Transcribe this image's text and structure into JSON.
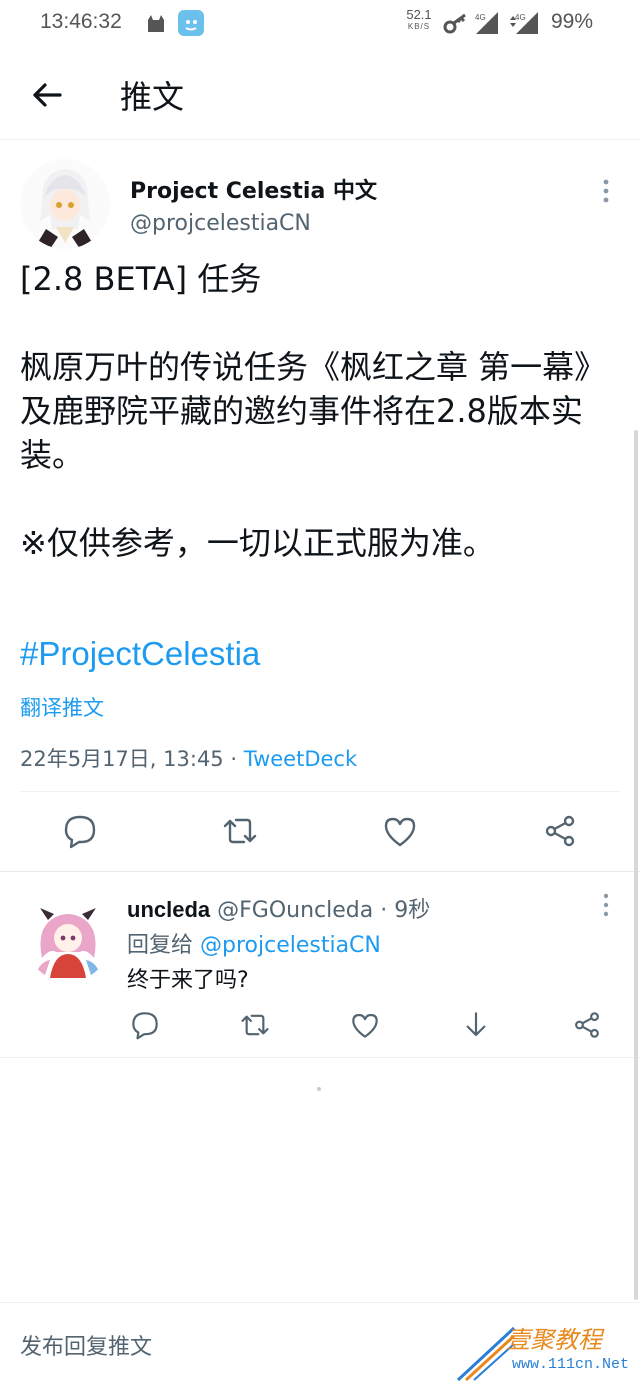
{
  "status_bar": {
    "time": "13:46:32",
    "net_speed_value": "52.1",
    "net_speed_unit": "KB/S",
    "signal1": "4G",
    "signal2": "4G",
    "battery": "99%"
  },
  "header": {
    "title": "推文"
  },
  "tweet": {
    "author_name": "Project Celestia 中文",
    "author_handle": "@projcelestiaCN",
    "body": "[2.8 BETA] 任务\n\n枫原万叶的传说任务《枫红之章 第一幕》及鹿野院平藏的邀约事件将在2.8版本实装。\n\n※仅供参考，一切以正式服为准。",
    "hashtag": "#ProjectCelestia",
    "translate_label": "翻译推文",
    "timestamp": "22年5月17日, 13:45",
    "separator": " · ",
    "source": "TweetDeck"
  },
  "reply": {
    "name": "uncleda",
    "handle": "@FGOuncleda",
    "dot": " · ",
    "time": "9秒",
    "reply_to_label": "回复给 ",
    "reply_to_handle": "@projcelestiaCN",
    "text": "终于来了吗?"
  },
  "compose": {
    "placeholder": "发布回复推文"
  },
  "watermark": {
    "text": "壹聚教程",
    "url": "www.111cn.Net"
  },
  "colors": {
    "accent": "#1d9bf0",
    "text_primary": "#0f1419",
    "text_secondary": "#536471",
    "divider": "#eff3f4"
  },
  "icons": {
    "back": "arrow-left-icon",
    "more": "more-vertical-icon",
    "reply": "comment-icon",
    "retweet": "retweet-icon",
    "like": "heart-icon",
    "share": "share-icon",
    "save": "download-arrow-icon"
  }
}
